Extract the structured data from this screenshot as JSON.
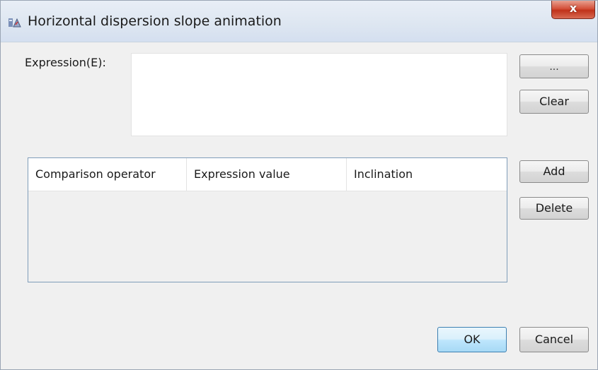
{
  "window": {
    "title": "Horizontal dispersion slope animation",
    "close_label": "x"
  },
  "expression": {
    "label": "Expression(E):",
    "value": "",
    "browse_label": "...",
    "clear_label": "Clear"
  },
  "table": {
    "columns": [
      "Comparison operator",
      "Expression value",
      "Inclination"
    ],
    "rows": []
  },
  "side_buttons": {
    "add_label": "Add",
    "delete_label": "Delete"
  },
  "footer": {
    "ok_label": "OK",
    "cancel_label": "Cancel"
  },
  "icons": {
    "title_icon": "app-icon",
    "close_icon": "close-icon"
  }
}
